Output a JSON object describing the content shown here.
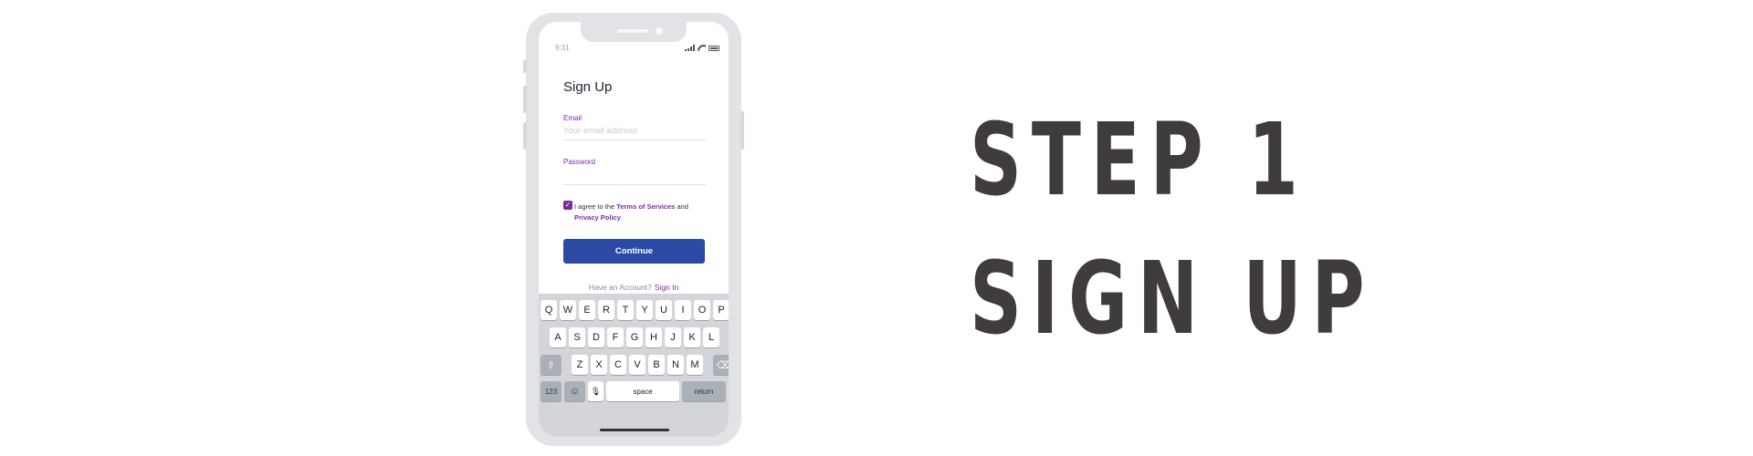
{
  "status_bar": {
    "time": "9:31"
  },
  "form": {
    "title": "Sign Up",
    "email_label": "Email",
    "email_placeholder": "Your email address",
    "password_label": "Password",
    "agree_prefix": "I agree to the ",
    "terms_link": "Terms of Services",
    "agree_and": " and",
    "privacy_link": "Privacy Policy",
    "agree_suffix": ".",
    "continue_label": "Continue",
    "have_account": "Have an Account?",
    "sign_in_link": "Sign In"
  },
  "keyboard": {
    "row1": [
      "Q",
      "W",
      "E",
      "R",
      "T",
      "Y",
      "U",
      "I",
      "O",
      "P"
    ],
    "row2": [
      "A",
      "S",
      "D",
      "F",
      "G",
      "H",
      "J",
      "K",
      "L"
    ],
    "row3": [
      "Z",
      "X",
      "C",
      "V",
      "B",
      "N",
      "M"
    ],
    "shift": "⇧",
    "backspace": "⌫",
    "numbers": "123",
    "emoji": "☺",
    "mic": "🎙",
    "space": "space",
    "return": "return"
  },
  "heading": {
    "line1": "STEP 1",
    "line2": "SIGN UP"
  },
  "colors": {
    "accent_purple": "#7b2a9e",
    "button_blue": "#2b4aa6",
    "heading_text": "#403c3c"
  }
}
